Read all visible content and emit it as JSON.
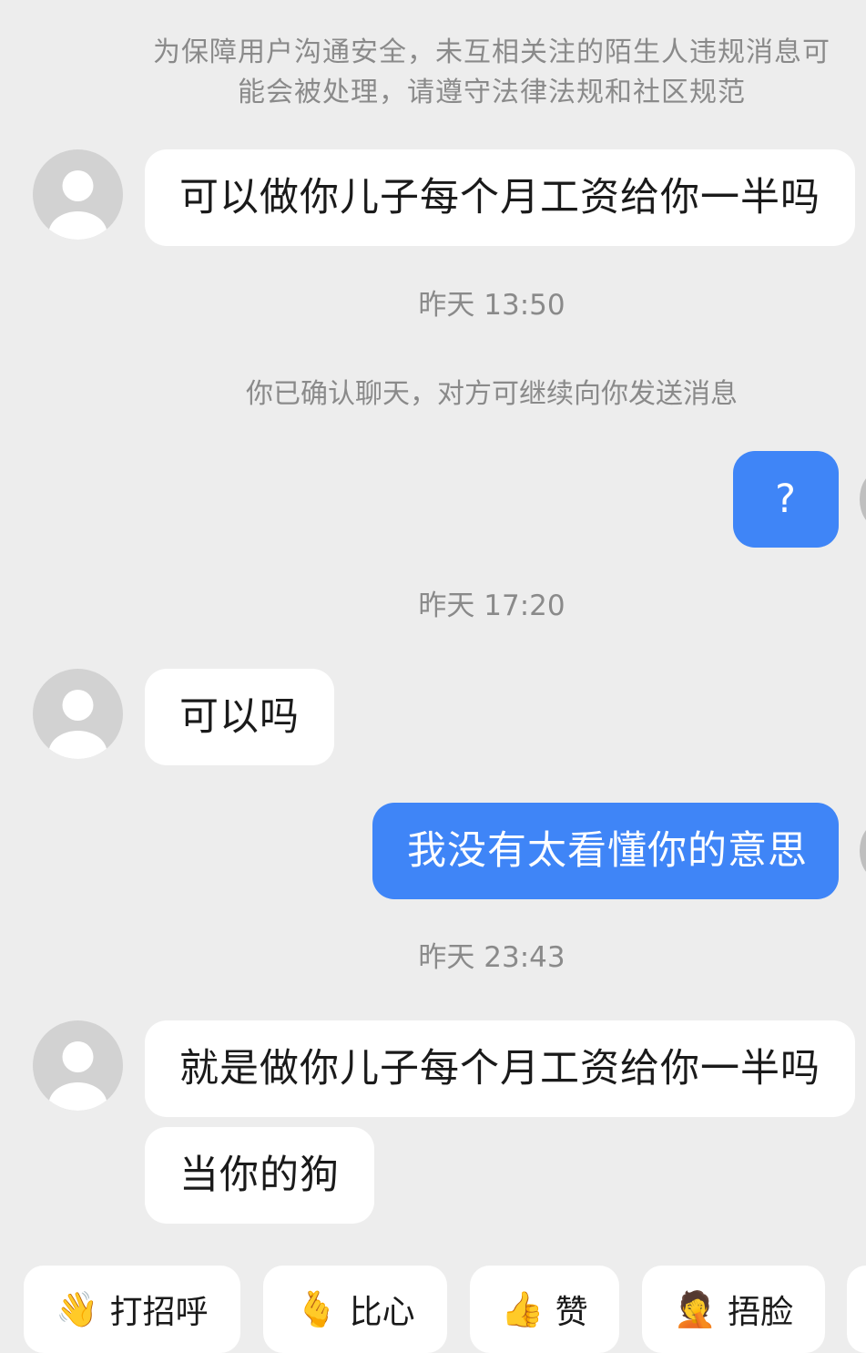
{
  "notice": {
    "line1": "为保障用户沟通安全，未互相关注的陌生人违规消息可",
    "line2": "能会被处理，请遵守法律法规和社区规范"
  },
  "messages": {
    "m1": "可以做你儿子每个月工资给你一半吗",
    "t1": "昨天 13:50",
    "sys1": "你已确认聊天，对方可继续向你发送消息",
    "m2": "?",
    "t2": "昨天 17:20",
    "m3": "可以吗",
    "m4": "我没有太看懂你的意思",
    "t3": "昨天 23:43",
    "m5": "就是做你儿子每个月工资给你一半吗",
    "m6": "当你的狗"
  },
  "quick_replies": {
    "greet": {
      "label": "打招呼",
      "icon": "waving-face-icon"
    },
    "heart": {
      "label": "比心",
      "icon": "finger-heart-icon"
    },
    "like": {
      "label": "赞",
      "icon": "thumbs-up-icon"
    },
    "facepalm": {
      "label": "捂脸",
      "icon": "facepalm-icon"
    }
  },
  "colors": {
    "background": "#ededed",
    "outgoing_bubble": "#3f85f7",
    "incoming_bubble": "#ffffff",
    "meta_text": "#8a8a8a"
  }
}
